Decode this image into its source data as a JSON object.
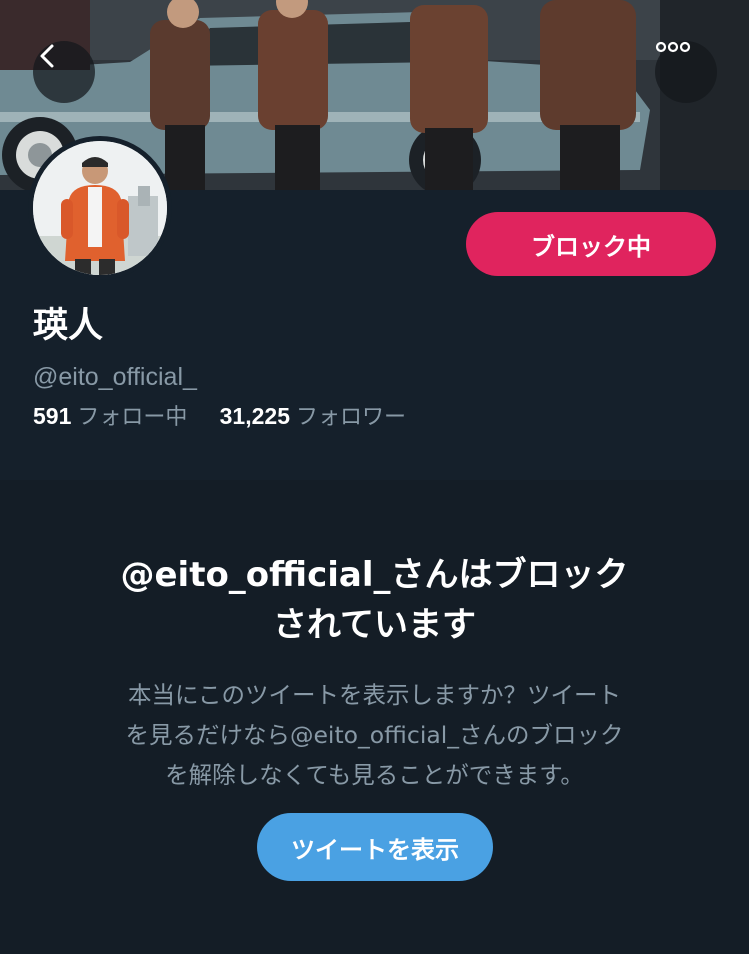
{
  "header": {
    "back_icon": "chevron-left-icon",
    "more_icon": "more-horizontal-icon"
  },
  "profile": {
    "display_name": "瑛人",
    "handle": "@eito_official_",
    "block_button_label": "ブロック中",
    "following_count": "591",
    "following_label": "フォロー中",
    "followers_count": "31,225",
    "followers_label": "フォロワー"
  },
  "blocked_notice": {
    "title_line1": "@eito_official_さんはブロック",
    "title_line2": "されています",
    "description_line1": "本当にこのツイートを表示しますか？ツイート",
    "description_line2": "を見るだけなら@eito_official_さんのブロック",
    "description_line3": "を解除しなくても見ることができます。",
    "show_tweets_button_label": "ツイートを表示"
  },
  "colors": {
    "background": "#15202b",
    "section_background": "#141d26",
    "block_button": "#e0245e",
    "show_button": "#4aa1e3",
    "secondary_text": "#8899a6"
  }
}
